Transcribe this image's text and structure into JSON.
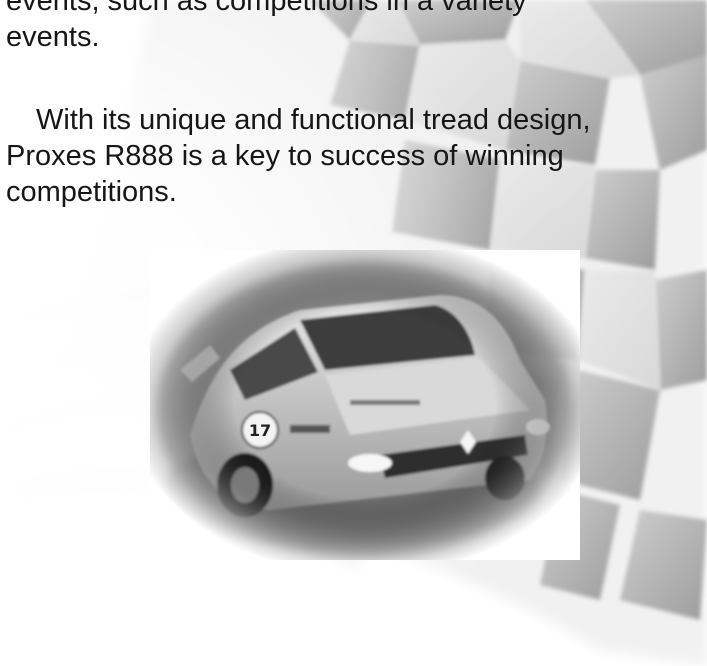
{
  "document": {
    "paragraph1": {
      "line1": "events, such as competitions in a variety",
      "line2": "events."
    },
    "paragraph2": {
      "line1": "With its unique and functional tread design,",
      "line2": "Proxes R888 is a key to success of winning",
      "line3": "competitions."
    }
  },
  "background": {
    "flag_icon": "checkered-flag",
    "photo": "rally-car-photo",
    "car_number": "17",
    "car_brand_mark": "three-diamond-emblem"
  },
  "colors": {
    "text": "#161616",
    "light_square": "#fafafa",
    "dark_square": "#b8b8b8"
  }
}
